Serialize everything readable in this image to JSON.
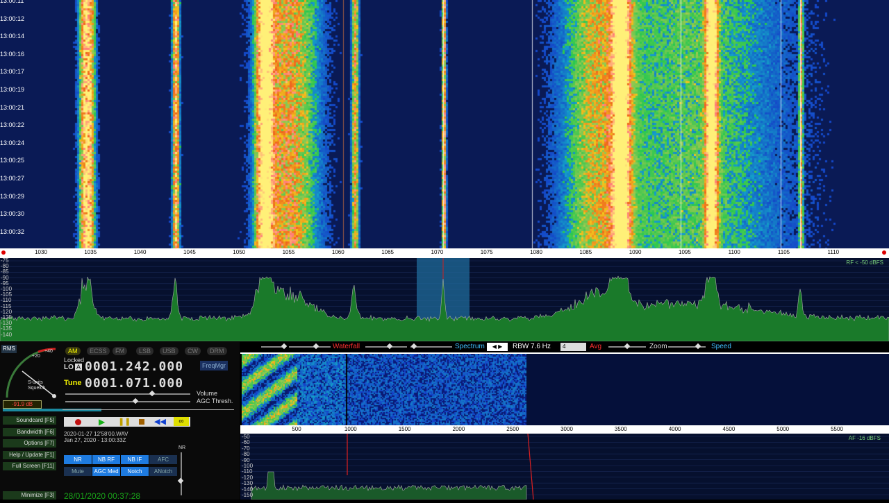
{
  "waterfall": {
    "times": [
      "13:00:11",
      "13:00:12",
      "13:00:14",
      "13:00:16",
      "13:00:17",
      "13:00:19",
      "13:00:21",
      "13:00:22",
      "13:00:24",
      "13:00:25",
      "13:00:27",
      "13:00:29",
      "13:00:30",
      "13:00:32"
    ]
  },
  "rf_axis": {
    "ticks": [
      "1030",
      "1035",
      "1040",
      "1045",
      "1050",
      "1055",
      "1060",
      "1065",
      "1070",
      "1075",
      "1080",
      "1085",
      "1090",
      "1095",
      "1100",
      "1105",
      "1110"
    ]
  },
  "rf_db": [
    "-75",
    "-80",
    "-85",
    "-90",
    "-95",
    "-100",
    "-105",
    "-110",
    "-115",
    "-120",
    "-125",
    "-130",
    "-135",
    "-140"
  ],
  "rf_note": "RF < -50 dBFS",
  "controls": {
    "waterfall_label": "Waterfall",
    "spectrum_label": "Spectrum",
    "rbw_label": "RBW",
    "rbw_value": "7.6 Hz",
    "avg_value": "4",
    "avg_label": "Avg",
    "zoom_label": "Zoom",
    "speed_label": "Speed"
  },
  "meter": {
    "rms": "RMS",
    "scale_top": "+40",
    "scale_mid": "+20",
    "s_units": "S-units",
    "squelch": "Squelch",
    "level": "-91.9 dB"
  },
  "modes": [
    "AM",
    "ECSS",
    "FM",
    "LSB",
    "USB",
    "CW",
    "DRM"
  ],
  "active_mode": "AM",
  "lo": {
    "locked": "Locked",
    "lo_label": "LO",
    "a_label": "A",
    "value": "0001.242.000"
  },
  "tune": {
    "label": "Tune",
    "value": "0001.071.000"
  },
  "freqmgr": "FreqMgr",
  "volume_label": "Volume",
  "agc_label": "AGC Thresh.",
  "menu_buttons": [
    "Soundcard [F5]",
    "Bandwidth [F6]",
    "Options [F7]",
    "Help / Update [F1]",
    "Full Screen [F11]"
  ],
  "minimize": "Minimize [F3]",
  "file": {
    "name": "2020-01-27 12'58'00.WAV",
    "date": "Jan 27, 2020 - 13:00:33Z"
  },
  "clock": "28/01/2020 00:37:28",
  "nr_label": "NR",
  "dsp_row1": [
    "NR",
    "NB RF",
    "NB IF",
    "AFC"
  ],
  "dsp_row2": [
    "Mute",
    "AGC Med",
    "Notch",
    "ANotch"
  ],
  "af_axis": {
    "ticks": [
      "500",
      "1000",
      "1500",
      "2000",
      "2500",
      "3000",
      "3500",
      "4000",
      "4500",
      "5000",
      "5500"
    ]
  },
  "af_db": [
    "-50",
    "-60",
    "-70",
    "-80",
    "-90",
    "-100",
    "-110",
    "-120",
    "-130",
    "-140",
    "-150"
  ],
  "af_note": "AF -16 dBFS",
  "colors": {
    "accent": "#1e7be0",
    "spectrum_fill": "#1a7a2a",
    "waterfall_bg": "#0a1a55"
  }
}
